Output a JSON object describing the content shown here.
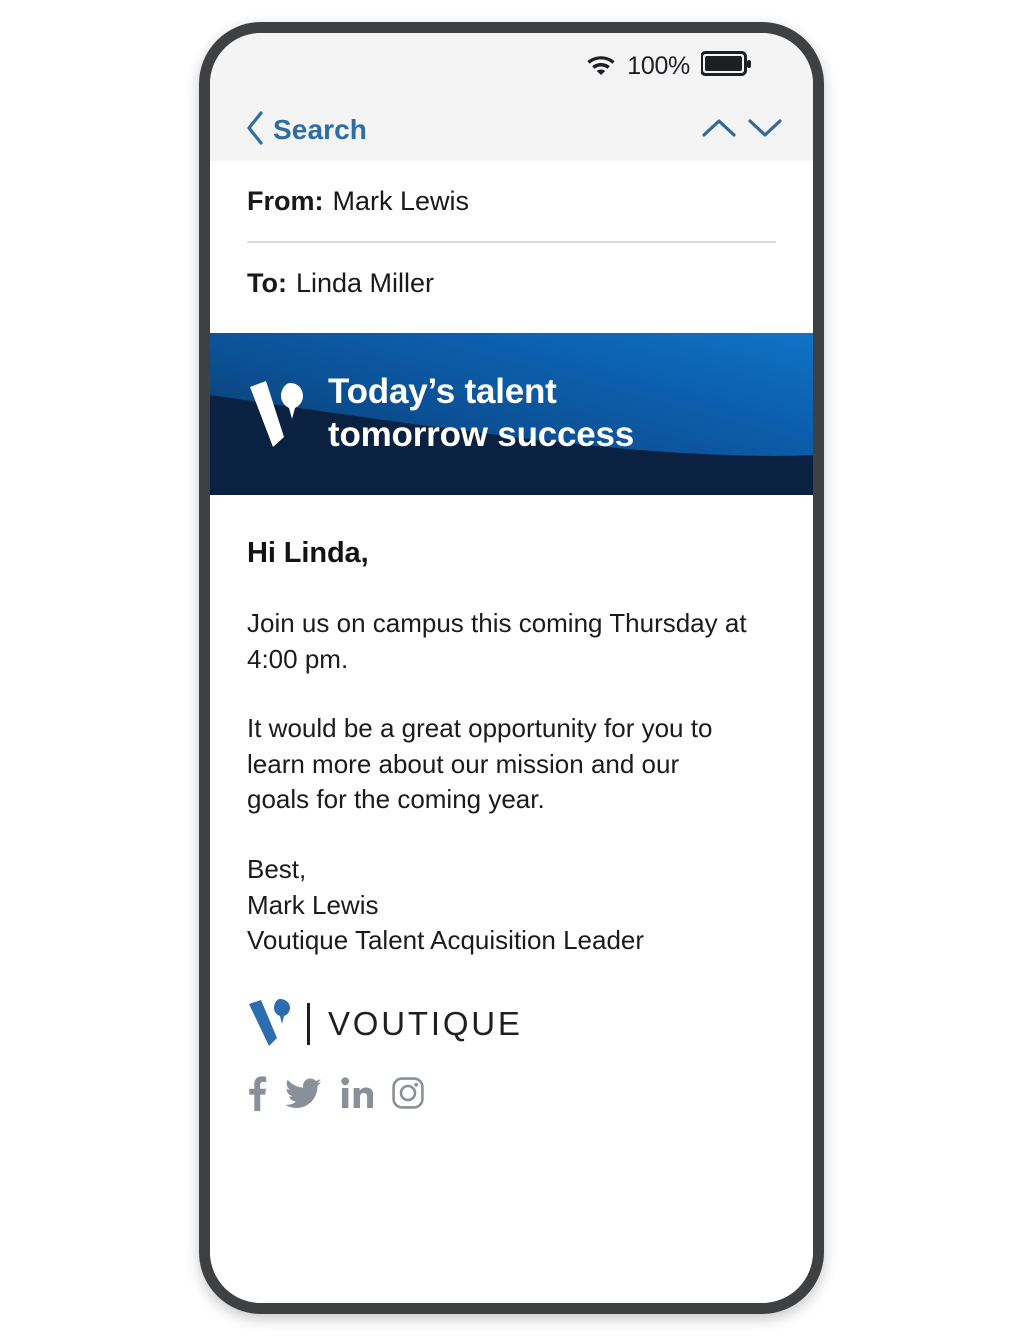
{
  "status_bar": {
    "wifi_icon": "wifi-icon",
    "battery_percent": "100%",
    "battery_icon": "battery-full-icon"
  },
  "nav_bar": {
    "back_icon": "chevron-left-icon",
    "back_label": "Search",
    "prev_icon": "chevron-up-icon",
    "next_icon": "chevron-down-icon"
  },
  "message_header": {
    "from_label": "From:",
    "from_value": "Mark Lewis",
    "to_label": "To:",
    "to_value": "Linda Miller"
  },
  "banner": {
    "logo_icon": "voutique-v-logo-icon",
    "tagline_line1": "Today’s talent",
    "tagline_line2": "tomorrow success",
    "color_light": "#0b5ca8",
    "color_dark": "#071f3d"
  },
  "body": {
    "greeting": "Hi Linda,",
    "paragraph1": "Join us on campus this coming Thursday at 4:00 pm.",
    "paragraph2": "It would be a great opportunity for you to learn more about our mission and our goals for the coming year.",
    "sign_off": "Best,",
    "sender_name": "Mark Lewis",
    "sender_title": "Voutique Talent Acquisition Leader"
  },
  "footer": {
    "brand_mark_icon": "voutique-v-logo-icon",
    "brand_name": "VOUTIQUE",
    "brand_color": "#2a6db0",
    "social": [
      {
        "name": "facebook-icon"
      },
      {
        "name": "twitter-icon"
      },
      {
        "name": "linkedin-icon"
      },
      {
        "name": "instagram-icon"
      }
    ]
  }
}
